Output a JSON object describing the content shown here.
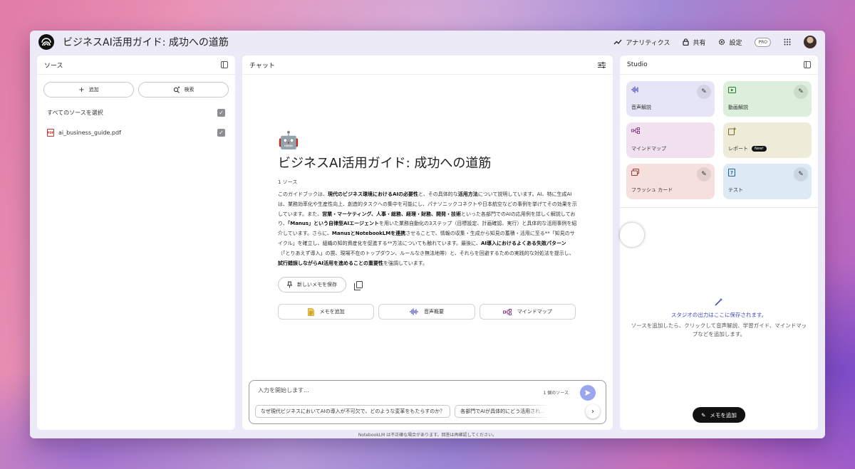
{
  "header": {
    "title": "ビジネスAI活用ガイド: 成功への道筋",
    "analytics": "アナリティクス",
    "share": "共有",
    "settings": "設定",
    "pro": "PRO"
  },
  "sources": {
    "title": "ソース",
    "add": "追加",
    "search": "検索",
    "select_all": "すべてのソースを選択",
    "file": "ai_business_guide.pdf"
  },
  "chat": {
    "title": "チャット",
    "notebook_title": "ビジネスAI活用ガイド: 成功への道筋",
    "source_count": "1 ソース",
    "summary": [
      {
        "t": "このガイドブックは、",
        "b": false
      },
      {
        "t": "現代のビジネス環境におけるAIの必要性",
        "b": true
      },
      {
        "t": "と、その具体的な",
        "b": false
      },
      {
        "t": "活用方法",
        "b": true
      },
      {
        "t": "について説明しています。AI、特に生成AIは、業務効率化や生産性向上、創造的タスクへの集中を可能にし、パナソニックコネクトや日本航空などの事例を挙げてその効果を示しています。また、",
        "b": false
      },
      {
        "t": "営業・マーケティング、人事・総務、経理・財務、開発・技術",
        "b": true
      },
      {
        "t": "といった各部門でのAIの応用例を詳しく解説しており、",
        "b": false
      },
      {
        "t": "「Manus」という自律型AIエージェント",
        "b": true
      },
      {
        "t": "を用いた業務自動化の3ステップ（目標設定、計画確認、実行）と具体的な活用事例を紹介しています。さらに、",
        "b": false
      },
      {
        "t": "ManusとNotebookLMを連携",
        "b": true
      },
      {
        "t": "させることで、情報の収集・生成から知見の蓄積・活用に至る**「知見のサイクル」を確立し、組織の知的資産化を促進する**方法についても触れています。最後に、",
        "b": false
      },
      {
        "t": "AI導入におけるよくある失敗パターン",
        "b": true
      },
      {
        "t": "（「とりあえず導入」の罠、現場不在のトップダウン、ルールなき無法地帯）と、それらを回避するための実践的な対処法を提示し、",
        "b": false
      },
      {
        "t": "試行錯誤しながらAI活用を進めることの重要性",
        "b": true
      },
      {
        "t": "を強調しています。",
        "b": false
      }
    ],
    "save_note": "新しいメモを保存",
    "actions": {
      "add_note": "メモを追加",
      "audio_overview": "音声概要",
      "mind_map": "マインドマップ"
    },
    "input_placeholder": "入力を開始します...",
    "input_source_tag": "1 個のソース",
    "suggestions": [
      "なぜ現代ビジネスにおいてAIの導入が不可欠で、どのような変革をもたらすのか？",
      "各部門でAIが具体的にどう活用され..."
    ]
  },
  "studio": {
    "title": "Studio",
    "tiles": {
      "audio": "音声解説",
      "video": "動画解説",
      "mindmap": "マインドマップ",
      "report": "レポート",
      "report_badge": "New!",
      "flashcard": "フラッシュ カード",
      "test": "テスト"
    },
    "empty_title": "スタジオの出力はここに保存されます。",
    "empty_desc": "ソースを追加したら、クリックして音声解説、学習ガイド、マインドマップなどを追加します。",
    "add_note": "メモを追加"
  },
  "footer": {
    "disclaimer": "NotebookLM は不正確な場合があります。回答は再確認してください。"
  }
}
